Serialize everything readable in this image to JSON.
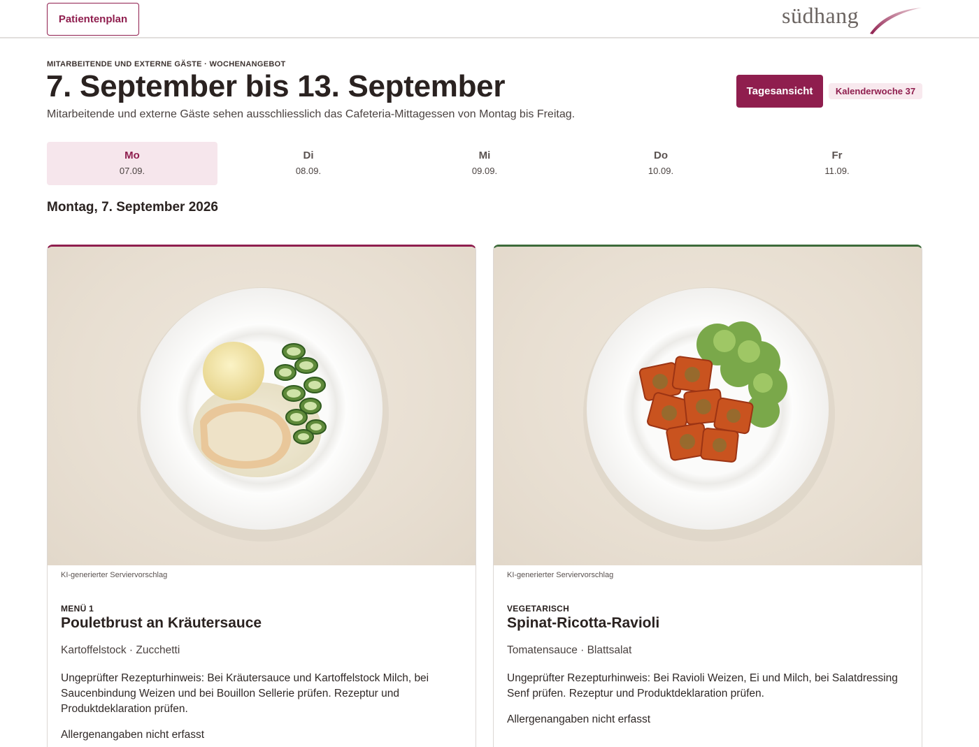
{
  "header": {
    "patient_button": "Patientenplan",
    "logo_text": "südhang"
  },
  "page": {
    "eyebrow": "MITARBEITENDE UND EXTERNE GÄSTE · WOCHENANGEBOT",
    "title": "7. September bis 13. September",
    "subtitle": "Mitarbeitende und externe Gäste sehen ausschliesslich das Cafeteria-Mittagessen von Montag bis Freitag.",
    "day_view_button": "Tagesansicht",
    "week_badge": "Kalenderwoche 37"
  },
  "days": [
    {
      "name": "Mo",
      "date": "07.09.",
      "active": true
    },
    {
      "name": "Di",
      "date": "08.09.",
      "active": false
    },
    {
      "name": "Mi",
      "date": "09.09.",
      "active": false
    },
    {
      "name": "Do",
      "date": "10.09.",
      "active": false
    },
    {
      "name": "Fr",
      "date": "11.09.",
      "active": false
    }
  ],
  "selected_date": "Montag, 7. September 2026",
  "menus": [
    {
      "image_caption": "KI-generierter Serviervorschlag",
      "category": "MENÜ 1",
      "title": "Pouletbrust an Kräutersauce",
      "sides": "Kartoffelstock · Zucchetti",
      "note": "Ungeprüfter Rezepturhinweis: Bei Kräutersauce und Kartoffelstock Milch, bei Saucenbindung Weizen und bei Bouillon Sellerie prüfen. Rezeptur und Produktdeklaration prüfen.",
      "allergy": "Allergenangaben nicht erfasst",
      "accent": "#8f1e4e"
    },
    {
      "image_caption": "KI-generierter Serviervorschlag",
      "category": "VEGETARISCH",
      "title": "Spinat-Ricotta-Ravioli",
      "sides": "Tomatensauce · Blattsalat",
      "note": "Ungeprüfter Rezepturhinweis: Bei Ravioli Weizen, Ei und Milch, bei Salatdressing Senf prüfen. Rezeptur und Produktdeklaration prüfen.",
      "allergy": "Allergenangaben nicht erfasst",
      "accent": "#3d6b3a"
    }
  ],
  "colors": {
    "brand": "#8f1e4e",
    "brand_light": "#f6e6ec",
    "vegetarian": "#3d6b3a"
  }
}
